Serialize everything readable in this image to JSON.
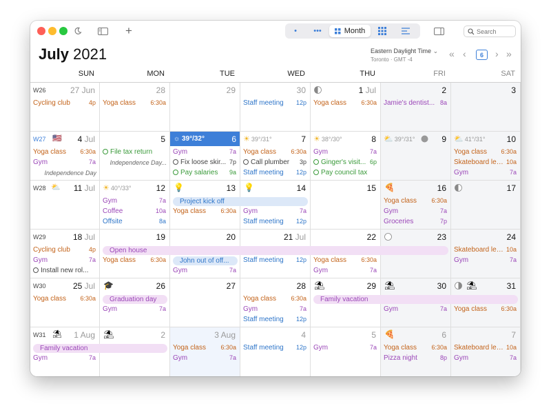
{
  "titlebar": {
    "views": [
      {
        "name": "day",
        "label": "•"
      },
      {
        "name": "week",
        "label": "•••"
      },
      {
        "name": "month",
        "label": "Month"
      },
      {
        "name": "year",
        "label": ""
      },
      {
        "name": "list",
        "label": ""
      }
    ],
    "search_placeholder": "Search"
  },
  "header": {
    "month": "July",
    "year": "2021",
    "timezone": "Eastern Daylight Time",
    "timezone_sub": "Toronto · GMT -4",
    "today_label": "6"
  },
  "weekdays": [
    "SUN",
    "MON",
    "TUE",
    "WED",
    "THU",
    "FRI",
    "SAT"
  ],
  "weeks": [
    {
      "label": "W26",
      "days": [
        {
          "num": "27",
          "mon": "Jun",
          "dim": true,
          "events": [
            {
              "title": "Cycling club",
              "time": "4p",
              "color": "orange"
            }
          ]
        },
        {
          "num": "28",
          "dim": true,
          "events": [
            {
              "title": "Yoga class",
              "time": "6:30a",
              "color": "orange"
            }
          ]
        },
        {
          "num": "29",
          "dim": true,
          "events": []
        },
        {
          "num": "30",
          "dim": true,
          "events": [
            {
              "title": "Staff meeting",
              "time": "12p",
              "color": "blue"
            }
          ]
        },
        {
          "num": "1",
          "mon": "Jul",
          "moon": "first-quarter",
          "events": [
            {
              "title": "Yoga class",
              "time": "6:30a",
              "color": "orange"
            }
          ]
        },
        {
          "num": "2",
          "events": [
            {
              "title": "Jamie's dentist...",
              "time": "8a",
              "color": "purple"
            }
          ]
        },
        {
          "num": "3",
          "events": []
        }
      ]
    },
    {
      "label": "W27",
      "days": [
        {
          "num": "4",
          "mon": "Jul",
          "flag": "🇺🇸",
          "events": [
            {
              "title": "Yoga class",
              "time": "6:30a",
              "color": "orange"
            },
            {
              "title": "Gym",
              "time": "7a",
              "color": "purple"
            }
          ],
          "holiday": "Independence Day"
        },
        {
          "num": "5",
          "events": [
            {
              "title": "File tax return",
              "time": "",
              "color": "green",
              "task": true
            }
          ],
          "holiday": "Independence Day..."
        },
        {
          "num": "6",
          "today": true,
          "weather": "39°/32°",
          "events": [
            {
              "title": "Gym",
              "time": "7a",
              "color": "purple"
            },
            {
              "title": "Fix loose skir...",
              "time": "7p",
              "color": "gray",
              "task": true
            },
            {
              "title": "Pay salaries",
              "time": "9a",
              "color": "green",
              "task": true
            }
          ]
        },
        {
          "num": "7",
          "weather": "39°/31°",
          "events": [
            {
              "title": "Yoga class",
              "time": "6:30a",
              "color": "orange"
            },
            {
              "title": "Call plumber",
              "time": "3p",
              "color": "gray",
              "task": true
            },
            {
              "title": "Staff meeting",
              "time": "12p",
              "color": "blue"
            }
          ]
        },
        {
          "num": "8",
          "weather": "38°/30°",
          "events": [
            {
              "title": "Gym",
              "time": "7a",
              "color": "purple"
            },
            {
              "title": "Ginger's visit...",
              "time": "6p",
              "color": "green",
              "task": true
            },
            {
              "title": "Pay council tax",
              "time": "",
              "color": "green",
              "task": true
            }
          ]
        },
        {
          "num": "9",
          "weather": "39°/31°",
          "moon": "new",
          "events": []
        },
        {
          "num": "10",
          "weather": "41°/31°",
          "events": [
            {
              "title": "Yoga class",
              "time": "6:30a",
              "color": "orange"
            },
            {
              "title": "Skateboard les...",
              "time": "10a",
              "color": "orange"
            },
            {
              "title": "Gym",
              "time": "7a",
              "color": "purple"
            }
          ]
        }
      ]
    },
    {
      "label": "W28",
      "days": [
        {
          "num": "11",
          "mon": "Jul",
          "events": []
        },
        {
          "num": "12",
          "weather": "40°/33°",
          "events": [
            {
              "title": "Gym",
              "time": "7a",
              "color": "purple"
            },
            {
              "title": "Coffee",
              "time": "10a",
              "color": "purple"
            },
            {
              "title": "Offsite",
              "time": "8a",
              "color": "blue"
            }
          ]
        },
        {
          "num": "13",
          "events": [
            {
              "title": "Yoga class",
              "time": "6:30a",
              "color": "orange"
            }
          ]
        },
        {
          "num": "14",
          "events": [
            {
              "title": "Gym",
              "time": "7a",
              "color": "purple"
            },
            {
              "title": "Staff meeting",
              "time": "12p",
              "color": "blue"
            }
          ]
        },
        {
          "num": "15",
          "events": []
        },
        {
          "num": "16",
          "events": [
            {
              "title": "Yoga class",
              "time": "6:30a",
              "color": "orange"
            },
            {
              "title": "Gym",
              "time": "7a",
              "color": "purple"
            },
            {
              "title": "Groceries",
              "time": "7p",
              "color": "purple"
            }
          ]
        },
        {
          "num": "17",
          "moon": "full-half",
          "events": []
        }
      ]
    },
    {
      "label": "W29",
      "days": [
        {
          "num": "18",
          "mon": "Jul",
          "events": [
            {
              "title": "Cycling club",
              "time": "4p",
              "color": "orange"
            },
            {
              "title": "Gym",
              "time": "7a",
              "color": "purple"
            },
            {
              "title": "Install new rol...",
              "time": "",
              "color": "gray",
              "task": true
            }
          ]
        },
        {
          "num": "19",
          "events": [
            {
              "title": "Yoga class",
              "time": "6:30a",
              "color": "orange"
            }
          ]
        },
        {
          "num": "20",
          "events": [
            {
              "title": "Gym",
              "time": "7a",
              "color": "purple"
            }
          ]
        },
        {
          "num": "21",
          "mon": "Jul",
          "events": [
            {
              "title": "Staff meeting",
              "time": "12p",
              "color": "blue"
            }
          ]
        },
        {
          "num": "22",
          "events": [
            {
              "title": "Yoga class",
              "time": "6:30a",
              "color": "orange"
            },
            {
              "title": "Gym",
              "time": "7a",
              "color": "purple"
            }
          ]
        },
        {
          "num": "23",
          "moon": "full",
          "events": []
        },
        {
          "num": "24",
          "events": [
            {
              "title": "Skateboard les...",
              "time": "10a",
              "color": "orange"
            },
            {
              "title": "Gym",
              "time": "7a",
              "color": "purple"
            }
          ]
        }
      ]
    },
    {
      "label": "W30",
      "days": [
        {
          "num": "25",
          "mon": "Jul",
          "events": [
            {
              "title": "Yoga class",
              "time": "6:30a",
              "color": "orange"
            }
          ]
        },
        {
          "num": "26",
          "events": [
            {
              "title": "Gym",
              "time": "7a",
              "color": "purple"
            }
          ]
        },
        {
          "num": "27",
          "events": []
        },
        {
          "num": "28",
          "events": [
            {
              "title": "Yoga class",
              "time": "6:30a",
              "color": "orange"
            },
            {
              "title": "Gym",
              "time": "7a",
              "color": "purple"
            },
            {
              "title": "Staff meeting",
              "time": "12p",
              "color": "blue"
            }
          ]
        },
        {
          "num": "29",
          "events": []
        },
        {
          "num": "30",
          "events": [
            {
              "title": "Gym",
              "time": "7a",
              "color": "purple"
            }
          ]
        },
        {
          "num": "31",
          "moon": "last-quarter",
          "events": [
            {
              "title": "Yoga class",
              "time": "6:30a",
              "color": "orange"
            }
          ]
        }
      ]
    },
    {
      "label": "W31",
      "days": [
        {
          "num": "1",
          "mon": "Aug",
          "dim": true,
          "events": [
            {
              "title": "Gym",
              "time": "7a",
              "color": "purple"
            }
          ]
        },
        {
          "num": "2",
          "dim": true,
          "events": []
        },
        {
          "num": "3",
          "mon": "Aug",
          "dim": true,
          "events": [
            {
              "title": "Yoga class",
              "time": "6:30a",
              "color": "orange"
            },
            {
              "title": "Gym",
              "time": "7a",
              "color": "purple"
            }
          ]
        },
        {
          "num": "4",
          "dim": true,
          "events": [
            {
              "title": "Staff meeting",
              "time": "12p",
              "color": "blue"
            }
          ]
        },
        {
          "num": "5",
          "dim": true,
          "events": [
            {
              "title": "Gym",
              "time": "7a",
              "color": "purple"
            }
          ]
        },
        {
          "num": "6",
          "dim": true,
          "events": [
            {
              "title": "Yoga class",
              "time": "6:30a",
              "color": "orange"
            },
            {
              "title": "Pizza night",
              "time": "8p",
              "color": "purple"
            }
          ]
        },
        {
          "num": "7",
          "dim": true,
          "events": [
            {
              "title": "Skateboard les...",
              "time": "10a",
              "color": "orange"
            },
            {
              "title": "Gym",
              "time": "7a",
              "color": "purple"
            }
          ]
        }
      ]
    }
  ],
  "allday_events": [
    {
      "title": "Project kick off",
      "week": 2,
      "start": 2,
      "span": 2,
      "color": "blue"
    },
    {
      "title": "Open house",
      "week": 3,
      "start": 1,
      "span": 5,
      "color": "purple"
    },
    {
      "title": "John out of off...",
      "week": 3,
      "start": 2,
      "span": 1,
      "color": "blue"
    },
    {
      "title": "Graduation day",
      "week": 4,
      "start": 1,
      "span": 1,
      "color": "purple"
    },
    {
      "title": "Family vacation",
      "week": 4,
      "start": 4,
      "span": 3,
      "color": "purple"
    },
    {
      "title": "Family vacation",
      "week": 5,
      "start": 0,
      "span": 2,
      "color": "purple"
    }
  ],
  "icons": {
    "lightbulb_days": [
      [
        2,
        2
      ],
      [
        2,
        3
      ]
    ],
    "pizza_days": [
      [
        2,
        5
      ],
      [
        5,
        5
      ]
    ],
    "beach_days": [
      [
        4,
        4
      ],
      [
        4,
        5
      ],
      [
        4,
        6
      ],
      [
        5,
        0
      ],
      [
        5,
        1
      ]
    ],
    "grad_day": [
      4,
      1
    ]
  },
  "colors": {
    "accent": "#3d7fd8",
    "orange": "#c3631a",
    "purple": "#9b47b8",
    "blue": "#2f76c9",
    "green": "#3a9a3a"
  }
}
